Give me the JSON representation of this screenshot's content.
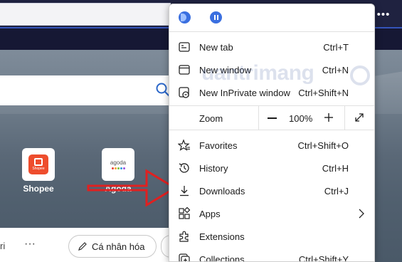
{
  "topbar": {
    "more_label": "•••"
  },
  "newtab": {
    "tiles": [
      {
        "label": "Shopee",
        "logo_text": "Shopee",
        "color": "#ee4d2d"
      },
      {
        "label": "Agoda",
        "logo_text": "agoda"
      }
    ],
    "bottombar": {
      "left_fragment": "ri",
      "more_label": "···",
      "personalize_label": "Cá nhân hóa"
    }
  },
  "menu": {
    "items": [
      {
        "label": "New tab",
        "shortcut": "Ctrl+T",
        "icon": "new-tab-icon"
      },
      {
        "label": "New window",
        "shortcut": "Ctrl+N",
        "icon": "new-window-icon"
      },
      {
        "label": "New InPrivate window",
        "shortcut": "Ctrl+Shift+N",
        "icon": "inprivate-icon"
      },
      {
        "label": "Favorites",
        "shortcut": "Ctrl+Shift+O",
        "icon": "favorites-icon"
      },
      {
        "label": "History",
        "shortcut": "Ctrl+H",
        "icon": "history-icon"
      },
      {
        "label": "Downloads",
        "shortcut": "Ctrl+J",
        "icon": "download-icon"
      },
      {
        "label": "Apps",
        "shortcut": "",
        "icon": "apps-icon"
      },
      {
        "label": "Extensions",
        "shortcut": "",
        "icon": "extensions-icon"
      },
      {
        "label": "Collections",
        "shortcut": "Ctrl+Shift+Y",
        "icon": "collections-icon"
      }
    ],
    "zoom": {
      "label": "Zoom",
      "value": "100%"
    }
  },
  "watermark": "uantrimang",
  "colors": {
    "accent": "#3a6fe0",
    "arrow": "#e02020",
    "shopee": "#ee4d2d"
  }
}
